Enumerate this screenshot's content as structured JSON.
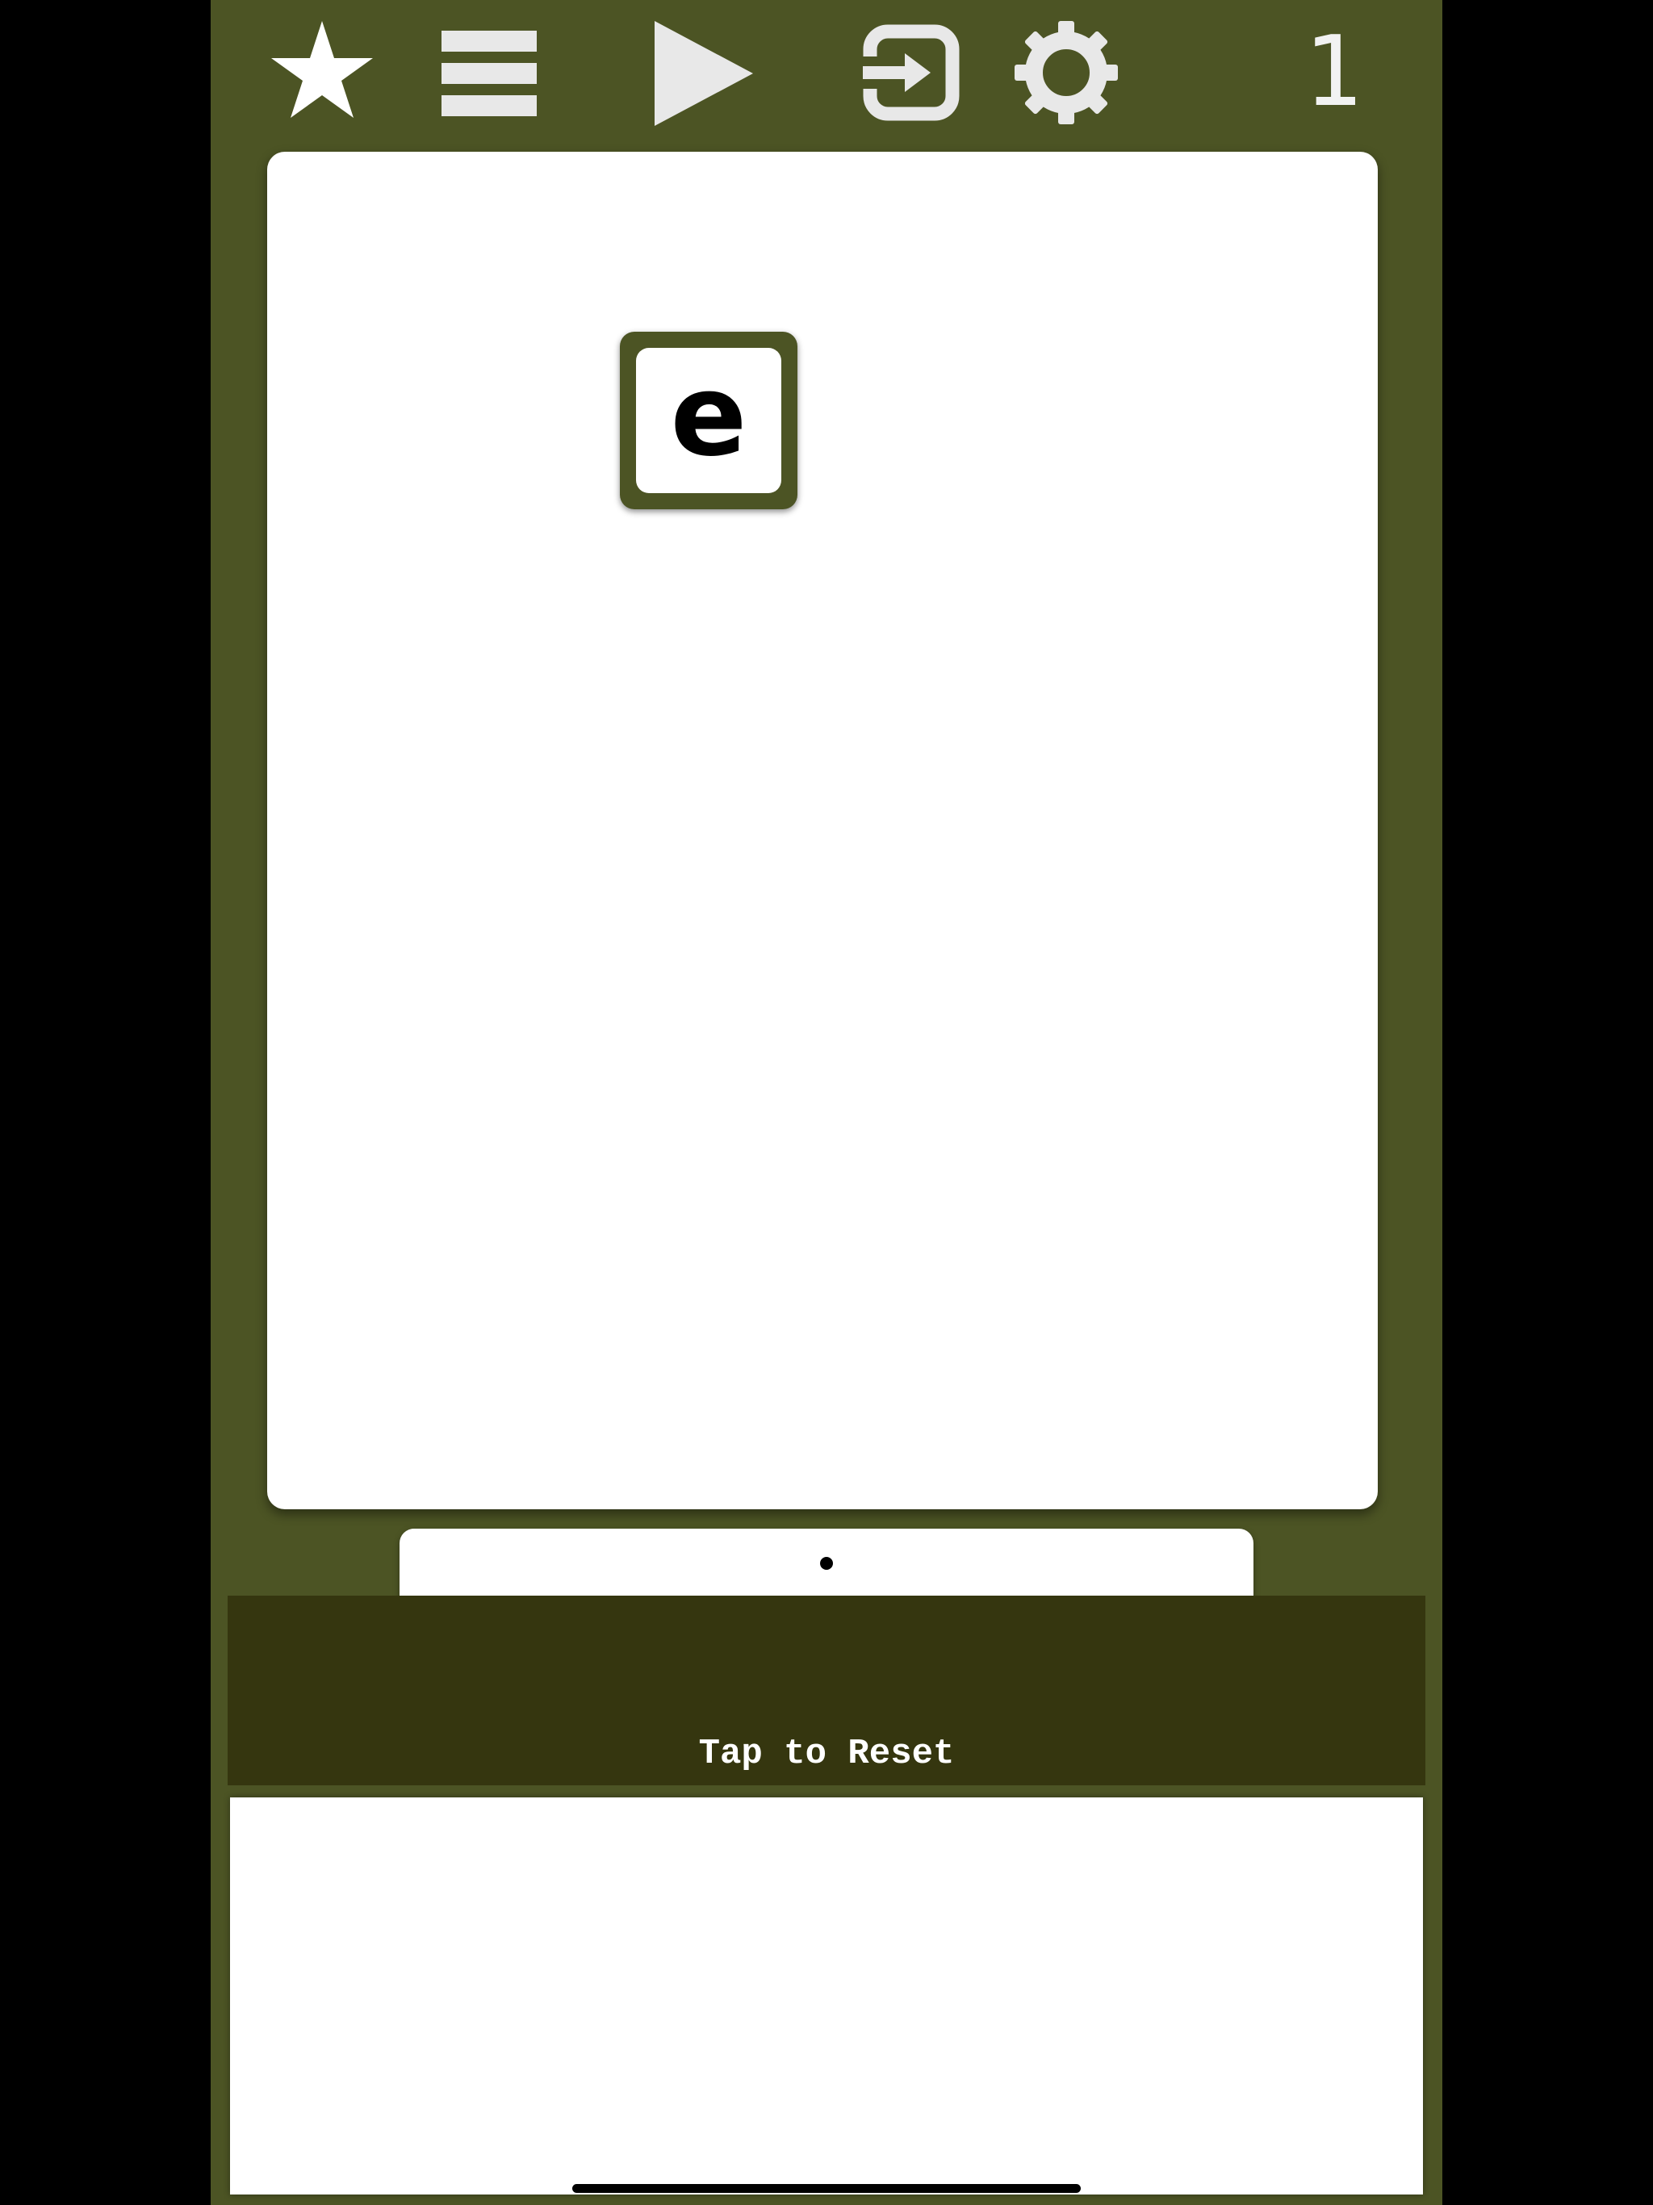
{
  "toolbar": {
    "buttons": [
      {
        "name": "star-icon",
        "label": "Favorites"
      },
      {
        "name": "menu-icon",
        "label": "Menu"
      },
      {
        "name": "play-icon",
        "label": "Play"
      },
      {
        "name": "exit-icon",
        "label": "Exit"
      },
      {
        "name": "gear-icon",
        "label": "Settings"
      }
    ],
    "icon_color": "#e8e8e8",
    "counter": "1"
  },
  "board": {
    "tiles": [
      {
        "letter": "e"
      }
    ]
  },
  "pager": {
    "pages": 1,
    "current": 1
  },
  "reset": {
    "label": "Tap to Reset"
  },
  "colors": {
    "background": "#4c5424",
    "reset_bar": "#35360f",
    "board": "#ffffff"
  }
}
